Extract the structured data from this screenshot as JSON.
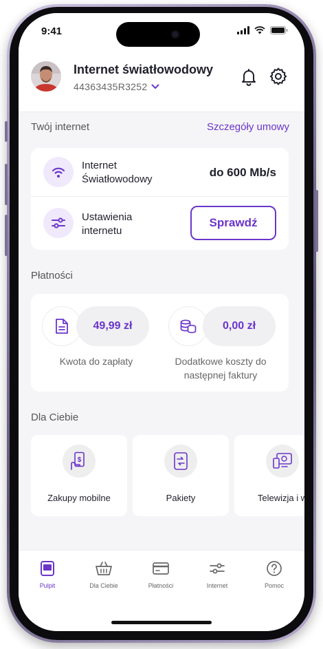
{
  "status_bar": {
    "time": "9:41"
  },
  "header": {
    "title": "Internet światłowodowy",
    "account_number": "44363435R3252"
  },
  "internet": {
    "section_label": "Twój internet",
    "contract_link": "Szczegóły umowy",
    "plan_label": "Internet Światłowodowy",
    "speed": "do 600 Mb/s",
    "settings_label": "Ustawienia internetu",
    "check_button": "Sprawdź"
  },
  "payments": {
    "section_label": "Płatności",
    "amount_due": "49,99 zł",
    "amount_due_caption": "Kwota do zapłaty",
    "extra_costs": "0,00 zł",
    "extra_costs_caption": "Dodatkowe koszty do następnej faktury"
  },
  "for_you": {
    "section_label": "Dla Ciebie",
    "tiles": [
      {
        "label": "Zakupy mobilne",
        "icon": "mobile-payment-icon"
      },
      {
        "label": "Pakiety",
        "icon": "packages-icon"
      },
      {
        "label": "Telewizja i w",
        "icon": "tv-icon"
      }
    ]
  },
  "tabbar": {
    "tabs": [
      {
        "label": "Pulpit",
        "icon": "dashboard-icon",
        "active": true
      },
      {
        "label": "Dla Ciebie",
        "icon": "basket-icon",
        "active": false
      },
      {
        "label": "Płatności",
        "icon": "card-icon",
        "active": false
      },
      {
        "label": "Internet",
        "icon": "sliders-icon",
        "active": false
      },
      {
        "label": "Pomoc",
        "icon": "help-icon",
        "active": false
      }
    ]
  },
  "colors": {
    "accent": "#6a35c9",
    "accent_light": "#efe9fb",
    "background": "#f5f5f7",
    "card": "#ffffff"
  }
}
